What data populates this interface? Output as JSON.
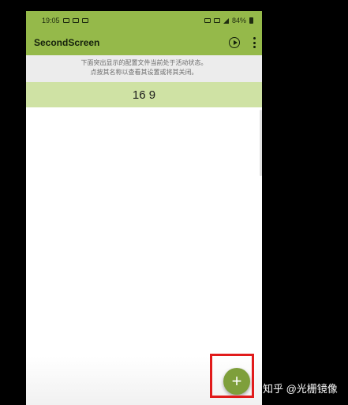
{
  "status_bar": {
    "time": "19:05",
    "battery_percent": "84%"
  },
  "app_bar": {
    "title": "SecondScreen"
  },
  "notice": {
    "line1": "下面突出显示的配置文件当前处于活动状态。",
    "line2": "点按其名称以查看其设置或将其关闭。"
  },
  "profile_list": {
    "items": [
      {
        "label": "16 9",
        "active": true
      }
    ]
  },
  "fab": {
    "label": "+",
    "icon": "add-icon"
  },
  "watermark": {
    "text": "知乎 @光栅镜像"
  },
  "colors": {
    "toolbar": "#95b94a",
    "active_row": "#cfe2a4",
    "fab": "#7e9f3b",
    "highlight_border": "#e11b1b"
  }
}
